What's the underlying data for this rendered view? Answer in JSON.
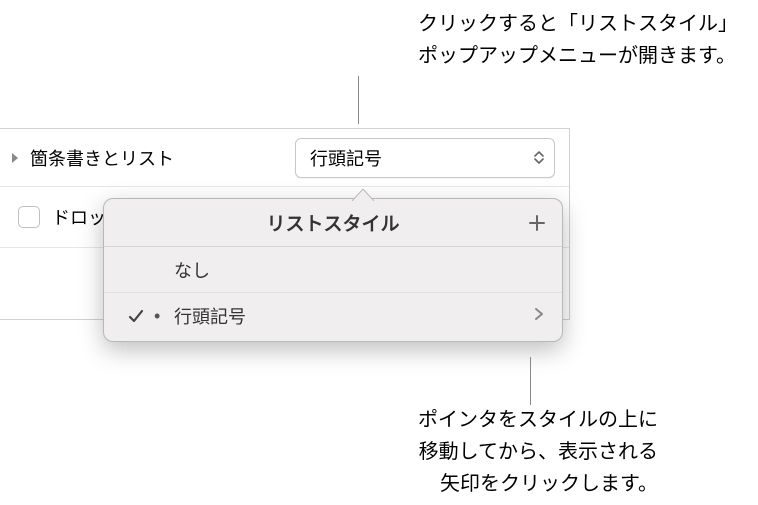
{
  "callouts": {
    "top_line1": "クリックすると「リストスタイル」",
    "top_line2": "ポップアップメニューが開きます。",
    "bottom_line1": "ポインタをスタイルの上に",
    "bottom_line2": "移動してから、表示される",
    "bottom_line3": "矢印をクリックします。"
  },
  "panel": {
    "section_label": "箇条書きとリスト",
    "dropdown_value": "行頭記号",
    "drop_label": "ドロッ"
  },
  "popover": {
    "title": "リストスタイル",
    "items": [
      {
        "label": "なし",
        "checked": false,
        "has_submenu": false,
        "bullet": ""
      },
      {
        "label": "行頭記号",
        "checked": true,
        "has_submenu": true,
        "bullet": "•"
      }
    ]
  }
}
